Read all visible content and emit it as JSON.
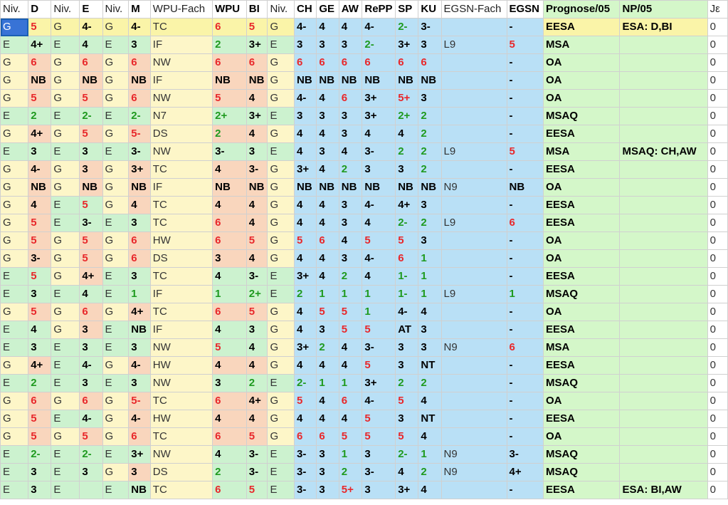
{
  "sheet": {
    "headers": [
      "Niv.",
      "D",
      "Niv.",
      "E",
      "Niv.",
      "M",
      "WPU-Fach",
      "WPU",
      "BI",
      "Niv.",
      "CH",
      "GE",
      "AW",
      "RePP",
      "SP",
      "KU",
      "EGSN-Fach",
      "EGSN",
      "Prognose/05",
      "NP/05",
      "Jε"
    ],
    "bold_headers": [
      1,
      3,
      5,
      7,
      8,
      10,
      11,
      12,
      13,
      14,
      15,
      17,
      18,
      19
    ],
    "rows": [
      {
        "cells": [
          "G",
          "5",
          "G",
          "4-",
          "G",
          "4-",
          "TC",
          "6",
          "5",
          "G",
          "4-",
          "4",
          "4",
          "4-",
          "2-",
          "3-",
          "",
          "-",
          "EESA",
          "ESA: D,BI",
          "0"
        ]
      },
      {
        "cells": [
          "E",
          "4+",
          "E",
          "4",
          "E",
          "3",
          "IF",
          "2",
          "3+",
          "E",
          "3",
          "3",
          "3",
          "2-",
          "3+",
          "3",
          "L9",
          "5",
          "MSA",
          "",
          "0"
        ]
      },
      {
        "cells": [
          "G",
          "6",
          "G",
          "6",
          "G",
          "6",
          "NW",
          "6",
          "6",
          "G",
          "6",
          "6",
          "6",
          "6",
          "6",
          "6",
          "",
          "-",
          "OA",
          "",
          "0"
        ]
      },
      {
        "cells": [
          "G",
          "NB",
          "G",
          "NB",
          "G",
          "NB",
          "IF",
          "NB",
          "NB",
          "G",
          "NB",
          "NB",
          "NB",
          "NB",
          "NB",
          "NB",
          "",
          "-",
          "OA",
          "",
          "0"
        ]
      },
      {
        "cells": [
          "G",
          "5",
          "G",
          "5",
          "G",
          "6",
          "NW",
          "5",
          "4",
          "G",
          "4-",
          "4",
          "6",
          "3+",
          "5+",
          "3",
          "",
          "-",
          "OA",
          "",
          "0"
        ]
      },
      {
        "cells": [
          "E",
          "2",
          "E",
          "2-",
          "E",
          "2-",
          "N7",
          "2+",
          "3+",
          "E",
          "3",
          "3",
          "3",
          "3+",
          "2+",
          "2",
          "",
          "-",
          "MSAQ",
          "",
          "0"
        ]
      },
      {
        "cells": [
          "G",
          "4+",
          "G",
          "5",
          "G",
          "5-",
          "DS",
          "2",
          "4",
          "G",
          "4",
          "4",
          "3",
          "4",
          "4",
          "2",
          "",
          "-",
          "EESA",
          "",
          "0"
        ]
      },
      {
        "cells": [
          "E",
          "3",
          "E",
          "3",
          "E",
          "3-",
          "NW",
          "3-",
          "3",
          "E",
          "4",
          "3",
          "4",
          "3-",
          "2",
          "2",
          "L9",
          "5",
          "MSA",
          "MSAQ: CH,AW",
          "0"
        ]
      },
      {
        "cells": [
          "G",
          "4-",
          "G",
          "3",
          "G",
          "3+",
          "TC",
          "4",
          "3-",
          "G",
          "3+",
          "4",
          "2",
          "3",
          "3",
          "2",
          "",
          "-",
          "EESA",
          "",
          "0"
        ]
      },
      {
        "cells": [
          "G",
          "NB",
          "G",
          "NB",
          "G",
          "NB",
          "IF",
          "NB",
          "NB",
          "G",
          "NB",
          "NB",
          "NB",
          "NB",
          "NB",
          "NB",
          "N9",
          "NB",
          "OA",
          "",
          "0"
        ]
      },
      {
        "cells": [
          "G",
          "4",
          "E",
          "5",
          "G",
          "4",
          "TC",
          "4",
          "4",
          "G",
          "4",
          "4",
          "3",
          "4-",
          "4+",
          "3",
          "",
          "-",
          "EESA",
          "",
          "0"
        ]
      },
      {
        "cells": [
          "G",
          "5",
          "E",
          "3-",
          "E",
          "3",
          "TC",
          "6",
          "4",
          "G",
          "4",
          "4",
          "3",
          "4",
          "2-",
          "2",
          "L9",
          "6",
          "EESA",
          "",
          "0"
        ]
      },
      {
        "cells": [
          "G",
          "5",
          "G",
          "5",
          "G",
          "6",
          "HW",
          "6",
          "5",
          "G",
          "5",
          "6",
          "4",
          "5",
          "5",
          "3",
          "",
          "-",
          "OA",
          "",
          "0"
        ]
      },
      {
        "cells": [
          "G",
          "3-",
          "G",
          "5",
          "G",
          "6",
          "DS",
          "3",
          "4",
          "G",
          "4",
          "4",
          "3",
          "4-",
          "6",
          "1",
          "",
          "-",
          "OA",
          "",
          "0"
        ]
      },
      {
        "cells": [
          "E",
          "5",
          "G",
          "4+",
          "E",
          "3",
          "TC",
          "4",
          "3-",
          "E",
          "3+",
          "4",
          "2",
          "4",
          "1-",
          "1",
          "",
          "-",
          "EESA",
          "",
          "0"
        ]
      },
      {
        "cells": [
          "E",
          "3",
          "E",
          "4",
          "E",
          "1",
          "IF",
          "1",
          "2+",
          "E",
          "2",
          "1",
          "1",
          "1",
          "1-",
          "1",
          "L9",
          "1",
          "MSAQ",
          "",
          "0"
        ]
      },
      {
        "cells": [
          "G",
          "5",
          "G",
          "6",
          "G",
          "4+",
          "TC",
          "6",
          "5",
          "G",
          "4",
          "5",
          "5",
          "1",
          "4-",
          "4",
          "",
          "-",
          "OA",
          "",
          "0"
        ]
      },
      {
        "cells": [
          "E",
          "4",
          "G",
          "3",
          "E",
          "NB",
          "IF",
          "4",
          "3",
          "G",
          "4",
          "3",
          "5",
          "5",
          "AT",
          "3",
          "",
          "-",
          "EESA",
          "",
          "0"
        ]
      },
      {
        "cells": [
          "E",
          "3",
          "E",
          "3",
          "E",
          "3",
          "NW",
          "5",
          "4",
          "G",
          "3+",
          "2",
          "4",
          "3-",
          "3",
          "3",
          "N9",
          "6",
          "MSA",
          "",
          "0"
        ]
      },
      {
        "cells": [
          "G",
          "4+",
          "E",
          "4-",
          "G",
          "4-",
          "HW",
          "4",
          "4",
          "G",
          "4",
          "4",
          "4",
          "5",
          "3",
          "NT",
          "",
          "-",
          "EESA",
          "",
          "0"
        ]
      },
      {
        "cells": [
          "E",
          "2",
          "E",
          "3",
          "E",
          "3",
          "NW",
          "3",
          "2",
          "E",
          "2-",
          "1",
          "1",
          "3+",
          "2",
          "2",
          "",
          "-",
          "MSAQ",
          "",
          "0"
        ]
      },
      {
        "cells": [
          "G",
          "6",
          "G",
          "6",
          "G",
          "5-",
          "TC",
          "6",
          "4+",
          "G",
          "5",
          "4",
          "6",
          "4-",
          "5",
          "4",
          "",
          "-",
          "OA",
          "",
          "0"
        ]
      },
      {
        "cells": [
          "G",
          "5",
          "E",
          "4-",
          "G",
          "4-",
          "HW",
          "4",
          "4",
          "G",
          "4",
          "4",
          "4",
          "5",
          "3",
          "NT",
          "",
          "-",
          "EESA",
          "",
          "0"
        ]
      },
      {
        "cells": [
          "G",
          "5",
          "G",
          "5",
          "G",
          "6",
          "TC",
          "6",
          "5",
          "G",
          "6",
          "6",
          "5",
          "5",
          "5",
          "4",
          "",
          "-",
          "OA",
          "",
          "0"
        ]
      },
      {
        "cells": [
          "E",
          "2-",
          "E",
          "2-",
          "E",
          "3+",
          "NW",
          "4",
          "3-",
          "E",
          "3-",
          "3",
          "1",
          "3",
          "2-",
          "1",
          "N9",
          "3-",
          "MSAQ",
          "",
          "0"
        ]
      },
      {
        "cells": [
          "E",
          "3",
          "E",
          "3",
          "G",
          "3",
          "DS",
          "2",
          "3-",
          "E",
          "3-",
          "3",
          "2",
          "3-",
          "4",
          "2",
          "N9",
          "4+",
          "MSAQ",
          "",
          "0"
        ]
      },
      {
        "cells": [
          "E",
          "3",
          "E",
          "",
          "E",
          "NB",
          "TC",
          "6",
          "5",
          "E",
          "3-",
          "3",
          "5+",
          "3",
          "3+",
          "4",
          "",
          "-",
          "EESA",
          "ESA: BI,AW",
          "0"
        ]
      }
    ],
    "colors": {
      "red": "#e8282b",
      "green": "#1f9a1f",
      "yellow": "#fdf6c8",
      "light_green": "#ccf2cf",
      "orange": "#f9d6bd",
      "blue": "#b9e0f6",
      "prognose_green": "#d4f7c9",
      "selection": "#3873d6"
    },
    "selected_cell": "A1"
  }
}
